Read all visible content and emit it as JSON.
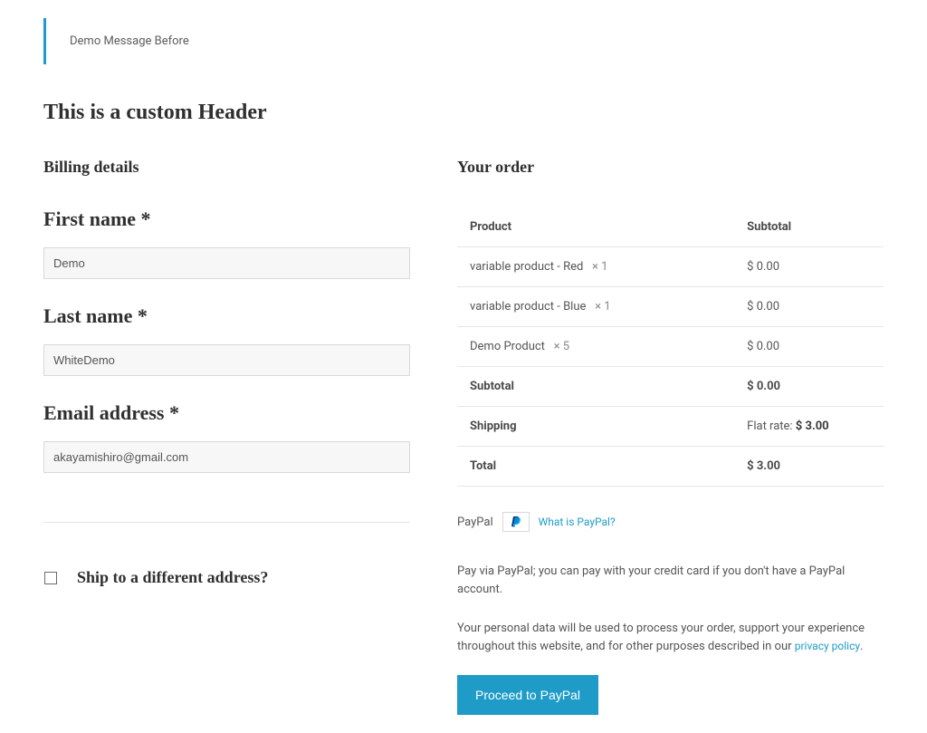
{
  "notice": "Demo Message Before",
  "page_heading": "This is a custom Header",
  "billing": {
    "title": "Billing details",
    "fields": {
      "first_name": {
        "label": "First name *",
        "value": "Demo"
      },
      "last_name": {
        "label": "Last name *",
        "value": "WhiteDemo"
      },
      "email": {
        "label": "Email address *",
        "value": "akayamishiro@gmail.com"
      }
    }
  },
  "ship_different": {
    "label": "Ship to a different address?",
    "checked": false
  },
  "order": {
    "title": "Your order",
    "headers": {
      "product": "Product",
      "subtotal": "Subtotal"
    },
    "items": [
      {
        "name": "variable product - Red",
        "qty": "× 1",
        "subtotal": "$ 0.00"
      },
      {
        "name": "variable product - Blue",
        "qty": "× 1",
        "subtotal": "$ 0.00"
      },
      {
        "name": "Demo Product",
        "qty": "× 5",
        "subtotal": "$ 0.00"
      }
    ],
    "subtotal": {
      "label": "Subtotal",
      "value": "$ 0.00"
    },
    "shipping": {
      "label": "Shipping",
      "value_prefix": "Flat rate: ",
      "value_amount": "$ 3.00"
    },
    "total": {
      "label": "Total",
      "value": "$ 3.00"
    }
  },
  "payment": {
    "method_label": "PayPal",
    "what_is_link": "What is PayPal?",
    "description": "Pay via PayPal; you can pay with your credit card if you don't have a PayPal account."
  },
  "privacy": {
    "text": "Your personal data will be used to process your order, support your experience throughout this website, and for other purposes described in our ",
    "link_text": "privacy policy",
    "suffix": "."
  },
  "proceed_button": "Proceed to PayPal"
}
